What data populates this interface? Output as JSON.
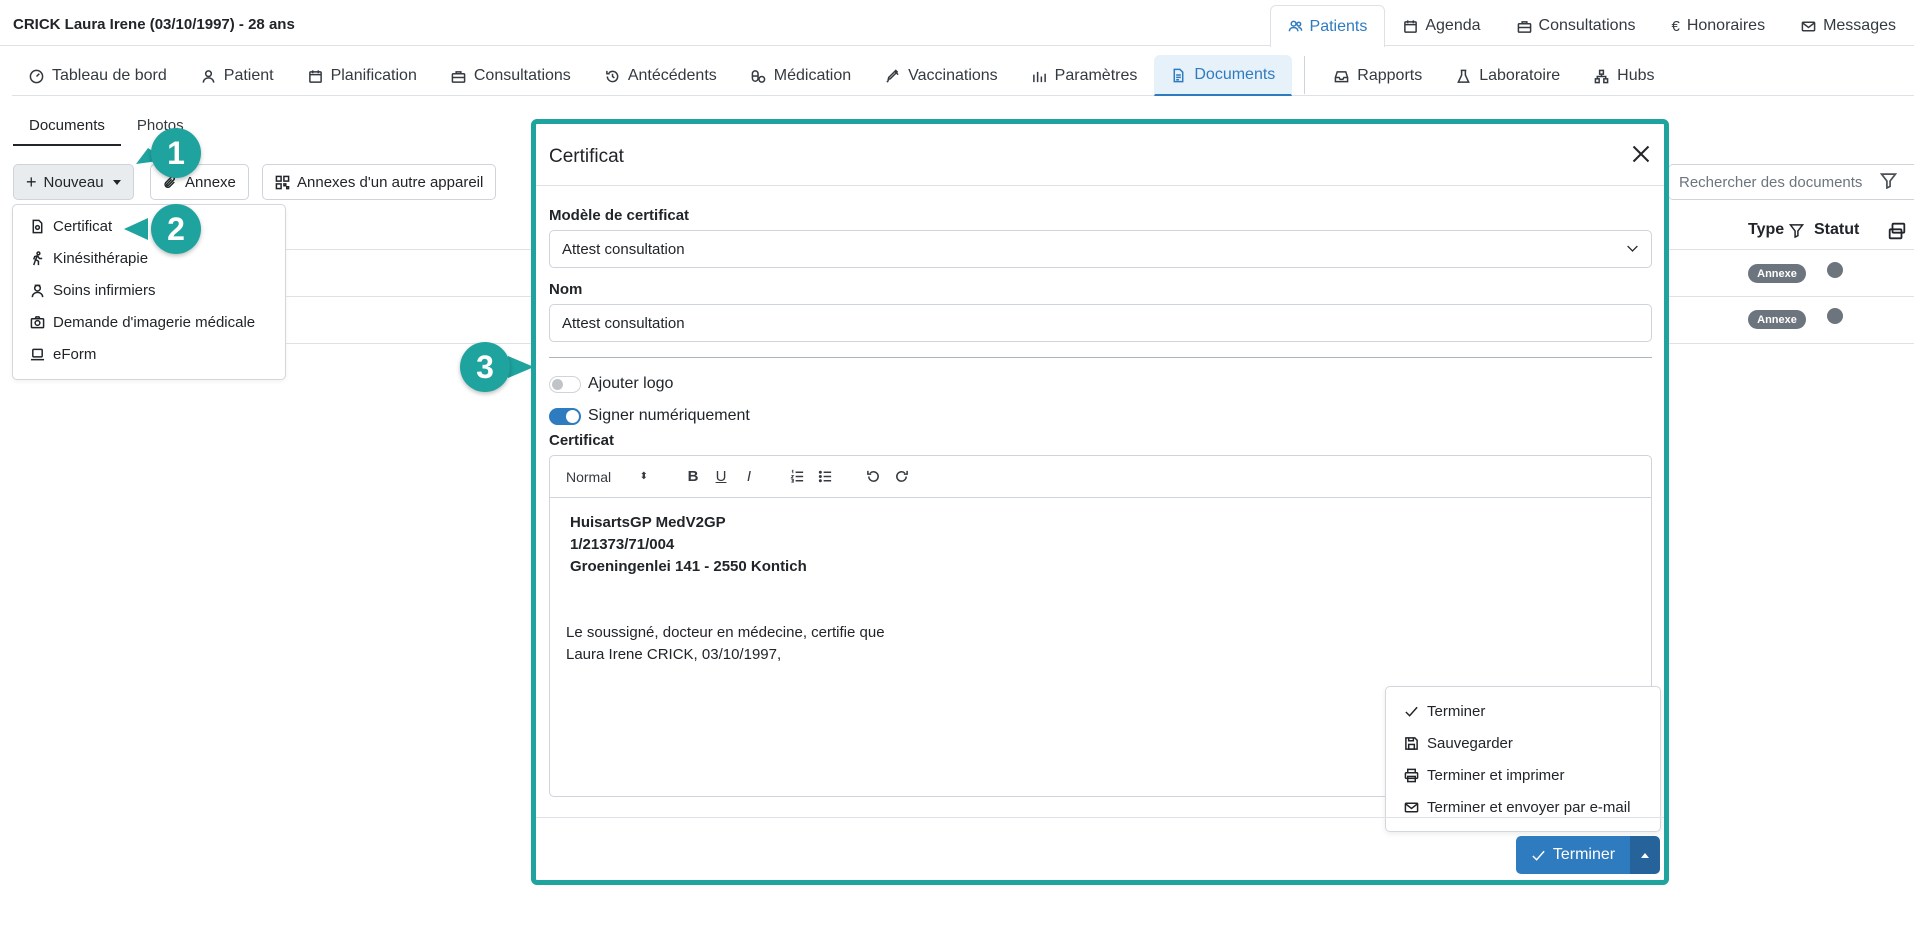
{
  "header": {
    "patient_title": "CRICK Laura Irene (03/10/1997) - 28 ans",
    "top_nav": [
      {
        "label": "Patients",
        "icon": "users-icon",
        "active": true
      },
      {
        "label": "Agenda",
        "icon": "calendar-icon"
      },
      {
        "label": "Consultations",
        "icon": "briefcase-icon"
      },
      {
        "label": "Honoraires",
        "icon": "euro-icon"
      },
      {
        "label": "Messages",
        "icon": "envelope-icon"
      }
    ]
  },
  "subnav": [
    {
      "label": "Tableau de bord",
      "icon": "dashboard-icon"
    },
    {
      "label": "Patient",
      "icon": "person-icon"
    },
    {
      "label": "Planification",
      "icon": "calendar-icon"
    },
    {
      "label": "Consultations",
      "icon": "briefcase-icon"
    },
    {
      "label": "Antécédents",
      "icon": "history-icon"
    },
    {
      "label": "Médication",
      "icon": "pills-icon"
    },
    {
      "label": "Vaccinations",
      "icon": "syringe-icon"
    },
    {
      "label": "Paramètres",
      "icon": "chart-icon"
    },
    {
      "label": "Documents",
      "icon": "document-icon",
      "active": true
    },
    {
      "label": "Rapports",
      "icon": "inbox-icon"
    },
    {
      "label": "Laboratoire",
      "icon": "flask-icon"
    },
    {
      "label": "Hubs",
      "icon": "network-icon"
    }
  ],
  "doc_tabs": [
    "Documents",
    "Photos"
  ],
  "toolbar": {
    "nouveau": "Nouveau",
    "annexe": "Annexe",
    "annexes_appareil": "Annexes d'un autre appareil",
    "search_placeholder": "Rechercher des documents"
  },
  "nouveau_menu": [
    {
      "label": "Certificat",
      "icon": "certificate-icon"
    },
    {
      "label": "Kinésithérapie",
      "icon": "walking-icon"
    },
    {
      "label": "Soins infirmiers",
      "icon": "nurse-icon"
    },
    {
      "label": "Demande d'imagerie médicale",
      "icon": "camera-icon"
    },
    {
      "label": "eForm",
      "icon": "laptop-icon"
    }
  ],
  "table": {
    "col_type": "Type",
    "col_statut": "Statut",
    "rows": [
      {
        "type_badge": "Annexe"
      },
      {
        "type_badge": "Annexe"
      }
    ]
  },
  "modal": {
    "title": "Certificat",
    "template_label": "Modèle de certificat",
    "template_value": "Attest consultation",
    "name_label": "Nom",
    "name_value": "Attest consultation",
    "toggle_logo": "Ajouter logo",
    "toggle_logo_on": false,
    "toggle_sign": "Signer numériquement",
    "toggle_sign_on": true,
    "editor_label": "Certificat",
    "format": "Normal",
    "editor_lines_bold": [
      "HuisartsGP MedV2GP",
      "1/21373/71/004",
      "Groeningenlei 141 - 2550 Kontich"
    ],
    "editor_lines": [
      "Le soussigné, docteur en médecine, certifie que",
      "Laura Irene CRICK, 03/10/1997,"
    ],
    "action_menu": [
      {
        "label": "Terminer",
        "icon": "check-icon"
      },
      {
        "label": "Sauvegarder",
        "icon": "save-icon"
      },
      {
        "label": "Terminer et imprimer",
        "icon": "printer-icon"
      },
      {
        "label": "Terminer et envoyer par e-mail",
        "icon": "envelope-icon"
      }
    ],
    "primary_button": "Terminer"
  },
  "callouts": [
    "1",
    "2",
    "3"
  ],
  "colors": {
    "accent": "#2f7bbf",
    "callout": "#1fa39f",
    "badge": "#6c757d"
  }
}
